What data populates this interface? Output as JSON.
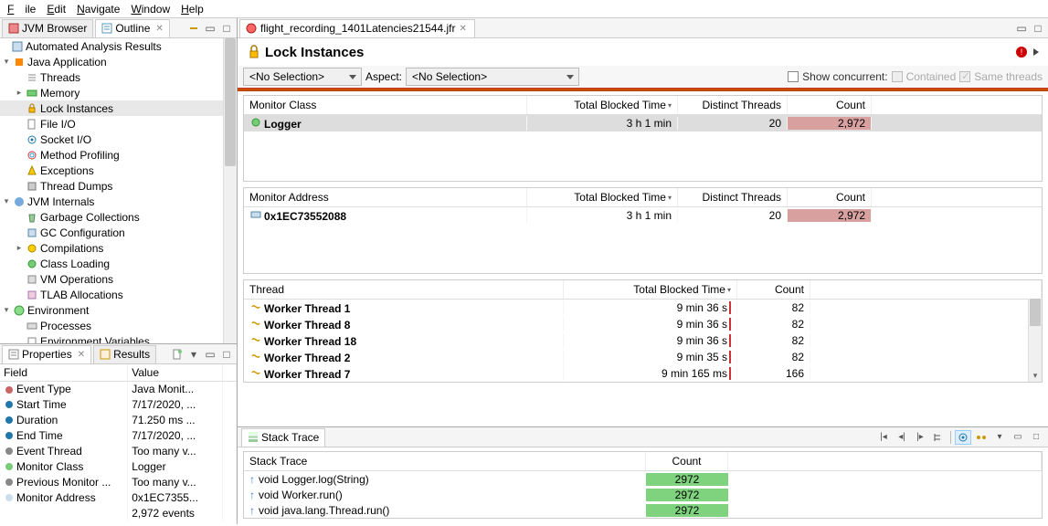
{
  "menu": {
    "file": "File",
    "edit": "Edit",
    "navigate": "Navigate",
    "window": "Window",
    "help": "Help"
  },
  "left_tabs": {
    "browser": "JVM Browser",
    "outline": "Outline"
  },
  "outline": {
    "automated": "Automated Analysis Results",
    "java_app": "Java Application",
    "threads": "Threads",
    "memory": "Memory",
    "lock_instances": "Lock Instances",
    "file_io": "File I/O",
    "socket_io": "Socket I/O",
    "method_profiling": "Method Profiling",
    "exceptions": "Exceptions",
    "thread_dumps": "Thread Dumps",
    "jvm_internals": "JVM Internals",
    "gc": "Garbage Collections",
    "gc_conf": "GC Configuration",
    "compilations": "Compilations",
    "class_loading": "Class Loading",
    "vm_ops": "VM Operations",
    "tlab": "TLAB Allocations",
    "environment": "Environment",
    "processes": "Processes",
    "env_vars": "Environment Variables"
  },
  "props_tabs": {
    "properties": "Properties",
    "results": "Results"
  },
  "props": {
    "hdr_field": "Field",
    "hdr_value": "Value",
    "rows": [
      {
        "f": "Event Type",
        "v": "Java Monit..."
      },
      {
        "f": "Start Time",
        "v": "7/17/2020, ..."
      },
      {
        "f": "Duration",
        "v": "71.250 ms ..."
      },
      {
        "f": "End Time",
        "v": "7/17/2020, ..."
      },
      {
        "f": "Event Thread",
        "v": "Too many v..."
      },
      {
        "f": "Monitor Class",
        "v": "Logger"
      },
      {
        "f": "Previous Monitor ...",
        "v": "Too many v..."
      },
      {
        "f": "Monitor Address",
        "v": "0x1EC7355..."
      }
    ],
    "footer": "2,972 events"
  },
  "editor": {
    "tab": "flight_recording_1401Latencies21544.jfr",
    "title": "Lock Instances"
  },
  "selectors": {
    "no_sel": "<No Selection>",
    "aspect": "Aspect:",
    "show_concurrent": "Show concurrent:",
    "contained": "Contained",
    "same_threads": "Same threads"
  },
  "table1": {
    "h1": "Monitor Class",
    "h2": "Total Blocked Time",
    "h3": "Distinct Threads",
    "h4": "Count",
    "row": {
      "c1": "Logger",
      "c2": "3 h 1 min",
      "c3": "20",
      "c4": "2,972"
    }
  },
  "table2": {
    "h1": "Monitor Address",
    "h2": "Total Blocked Time",
    "h3": "Distinct Threads",
    "h4": "Count",
    "row": {
      "c1": "0x1EC73552088",
      "c2": "3 h 1 min",
      "c3": "20",
      "c4": "2,972"
    }
  },
  "table3": {
    "h1": "Thread",
    "h2": "Total Blocked Time",
    "h3": "Count",
    "rows": [
      {
        "c1": "Worker Thread 1",
        "c2": "9 min 36 s",
        "c3": "82"
      },
      {
        "c1": "Worker Thread 8",
        "c2": "9 min 36 s",
        "c3": "82"
      },
      {
        "c1": "Worker Thread 18",
        "c2": "9 min 36 s",
        "c3": "82"
      },
      {
        "c1": "Worker Thread 2",
        "c2": "9 min 35 s",
        "c3": "82"
      },
      {
        "c1": "Worker Thread 7",
        "c2": "9 min 165 ms",
        "c3": "166"
      }
    ]
  },
  "stack": {
    "title": "Stack Trace",
    "h1": "Stack Trace",
    "h2": "Count",
    "rows": [
      {
        "m": "void Logger.log(String)",
        "c": "2972"
      },
      {
        "m": "void Worker.run()",
        "c": "2972"
      },
      {
        "m": "void java.lang.Thread.run()",
        "c": "2972"
      }
    ]
  }
}
